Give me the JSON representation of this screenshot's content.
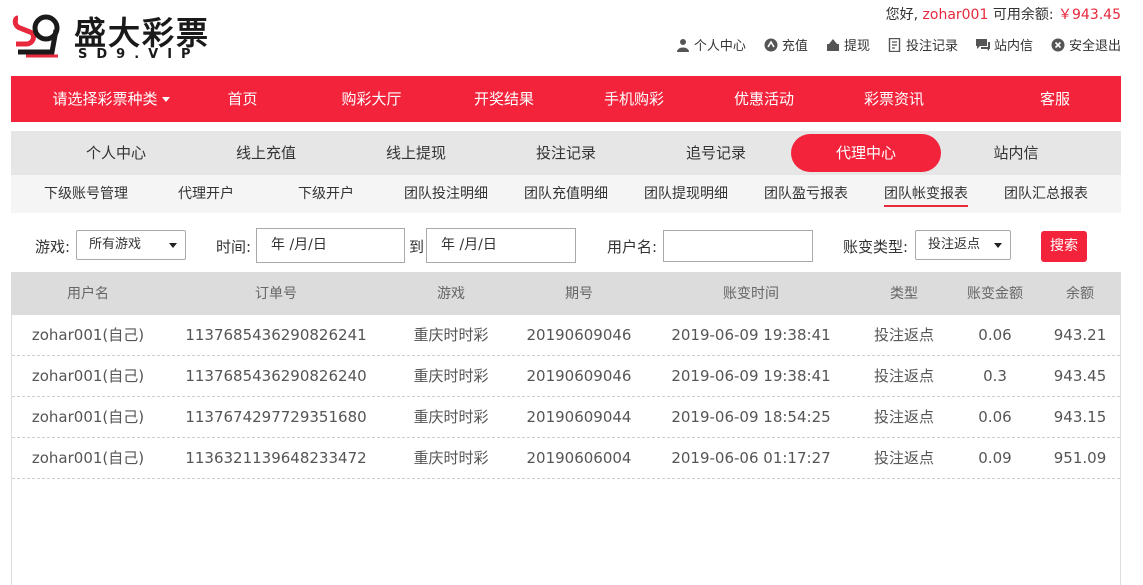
{
  "brand": {
    "title": "盛大彩票",
    "subtitle": "SD9.VIP",
    "accent": "#f2233b"
  },
  "account": {
    "greeting": "您好,",
    "username": "zohar001",
    "balance_label": "可用余额:",
    "balance_value": "￥943.45"
  },
  "toplinks": [
    {
      "label": "个人中心",
      "icon": "user-icon"
    },
    {
      "label": "充值",
      "icon": "recharge-icon"
    },
    {
      "label": "提现",
      "icon": "withdraw-icon"
    },
    {
      "label": "投注记录",
      "icon": "record-icon"
    },
    {
      "label": "站内信",
      "icon": "message-icon"
    },
    {
      "label": "安全退出",
      "icon": "logout-icon"
    }
  ],
  "mainnav": [
    "请选择彩票种类",
    "首页",
    "购彩大厅",
    "开奖结果",
    "手机购彩",
    "优惠活动",
    "彩票资讯",
    "客服"
  ],
  "subnav": [
    "个人中心",
    "线上充值",
    "线上提现",
    "投注记录",
    "追号记录",
    "代理中心",
    "站内信"
  ],
  "subnav_active": "代理中心",
  "thirdnav": [
    "下级账号管理",
    "代理开户",
    "下级开户",
    "团队投注明细",
    "团队充值明细",
    "团队提现明细",
    "团队盈亏报表",
    "团队帐变报表",
    "团队汇总报表"
  ],
  "thirdnav_active": "团队帐变报表",
  "filters": {
    "game_label": "游戏:",
    "game_value": "所有游戏",
    "time_label": "时间:",
    "date_from": "年 /月/日",
    "to_label": "到",
    "date_to": "年 /月/日",
    "user_label": "用户名:",
    "user_value": "",
    "type_label": "账变类型:",
    "type_value": "投注返点",
    "search_label": "搜索"
  },
  "table": {
    "columns": [
      "用户名",
      "订单号",
      "游戏",
      "期号",
      "账变时间",
      "类型",
      "账变金额",
      "余额"
    ],
    "rows": [
      [
        "zohar001(自己)",
        "1137685436290826241",
        "重庆时时彩",
        "20190609046",
        "2019-06-09 19:38:41",
        "投注返点",
        "0.06",
        "943.21"
      ],
      [
        "zohar001(自己)",
        "1137685436290826240",
        "重庆时时彩",
        "20190609046",
        "2019-06-09 19:38:41",
        "投注返点",
        "0.3",
        "943.45"
      ],
      [
        "zohar001(自己)",
        "1137674297729351680",
        "重庆时时彩",
        "20190609044",
        "2019-06-09 18:54:25",
        "投注返点",
        "0.06",
        "943.15"
      ],
      [
        "zohar001(自己)",
        "1136321139648233472",
        "重庆时时彩",
        "20190606004",
        "2019-06-06 01:17:27",
        "投注返点",
        "0.09",
        "951.09"
      ]
    ]
  }
}
